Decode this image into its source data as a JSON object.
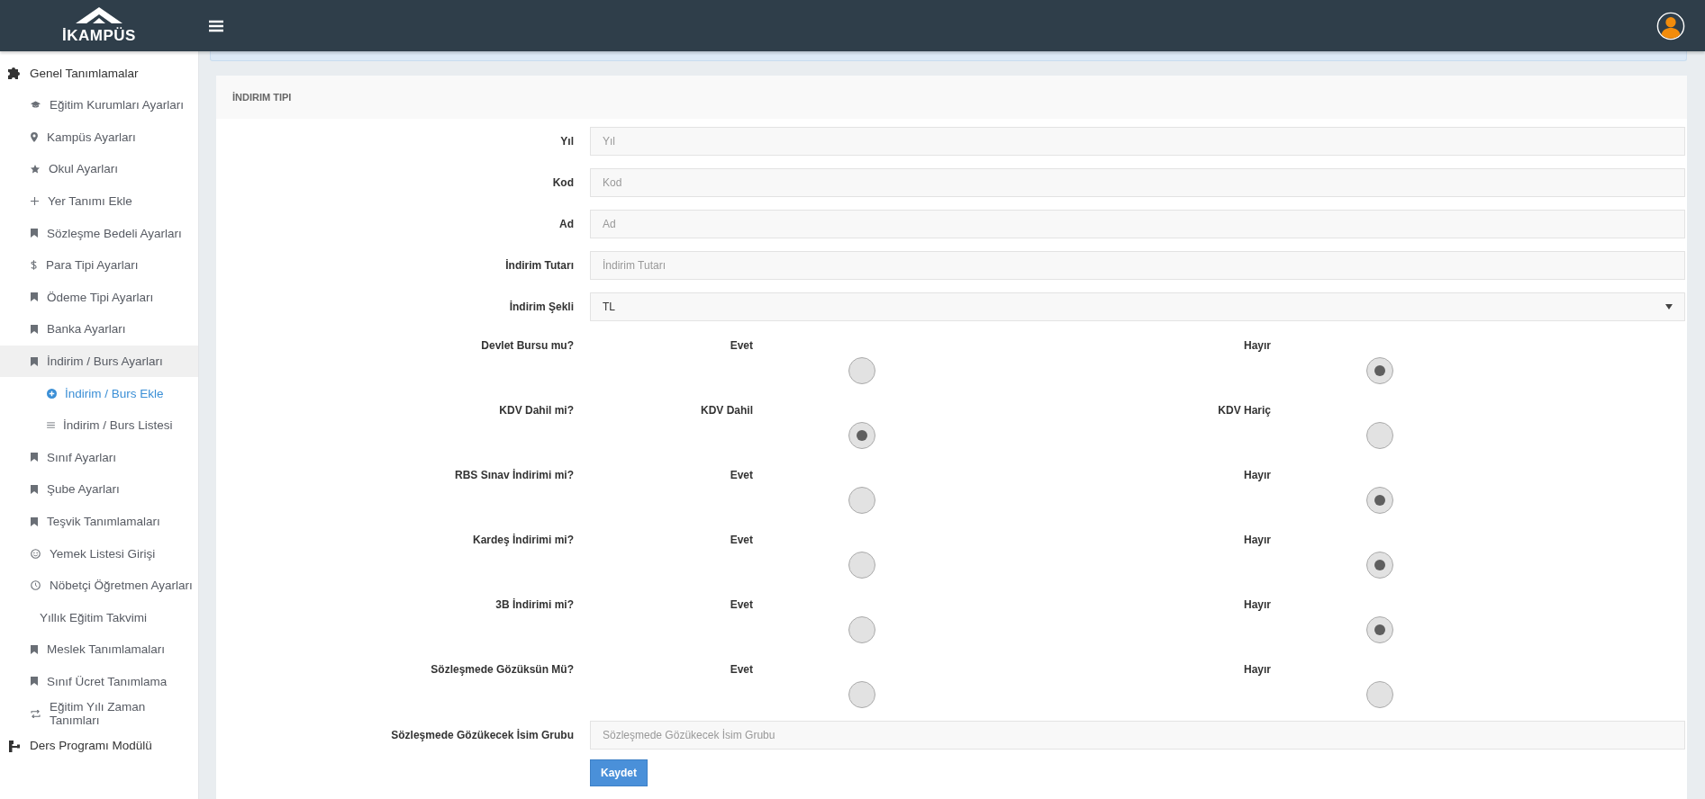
{
  "header": {
    "logo_text": "İKAMPÜS"
  },
  "sidebar": {
    "sections": [
      {
        "label": "Genel Tanımlamalar",
        "expanded": true,
        "items": [
          {
            "label": "Eğitim Kurumları Ayarları",
            "selected": false
          },
          {
            "label": "Kampüs Ayarları",
            "selected": false
          },
          {
            "label": "Okul Ayarları",
            "selected": false
          },
          {
            "label": "Yer Tanımı Ekle",
            "selected": false
          },
          {
            "label": "Sözleşme Bedeli Ayarları",
            "selected": false
          },
          {
            "label": "Para Tipi Ayarları",
            "selected": false
          },
          {
            "label": "Ödeme Tipi Ayarları",
            "selected": false
          },
          {
            "label": "Banka Ayarları",
            "selected": false
          },
          {
            "label": "İndirim / Burs Ayarları",
            "selected": true,
            "children": [
              {
                "label": "İndirim / Burs Ekle",
                "selected": true
              },
              {
                "label": "İndirim / Burs Listesi",
                "selected": false
              }
            ]
          },
          {
            "label": "Sınıf Ayarları",
            "selected": false
          },
          {
            "label": "Şube Ayarları",
            "selected": false
          },
          {
            "label": "Teşvik Tanımlamaları",
            "selected": false
          },
          {
            "label": "Yemek Listesi Girişi",
            "selected": false
          },
          {
            "label": "Nöbetçi Öğretmen Ayarları",
            "selected": false
          },
          {
            "label": "Yıllık Eğitim Takvimi",
            "selected": false
          },
          {
            "label": "Meslek Tanımlamaları",
            "selected": false
          },
          {
            "label": "Sınıf Ücret Tanımlama",
            "selected": false
          },
          {
            "label": "Eğitim Yılı Zaman Tanımları",
            "selected": false
          }
        ]
      },
      {
        "label": "Ders Programı Modülü",
        "expanded": false
      }
    ]
  },
  "card": {
    "title": "İNDIRIM TIPI",
    "fields": [
      {
        "kind": "text",
        "label": "Yıl",
        "placeholder": "Yıl"
      },
      {
        "kind": "text",
        "label": "Kod",
        "placeholder": "Kod"
      },
      {
        "kind": "text",
        "label": "Ad",
        "placeholder": "Ad"
      },
      {
        "kind": "text",
        "label": "İndirim Tutarı",
        "placeholder": "İndirim Tutarı"
      },
      {
        "kind": "select",
        "label": "İndirim Şekli",
        "value": "TL"
      },
      {
        "kind": "radio",
        "label": "Devlet Bursu mu?",
        "options": [
          {
            "label": "Evet",
            "selected": false
          },
          {
            "label": "Hayır",
            "selected": true
          }
        ]
      },
      {
        "kind": "radio",
        "label": "KDV Dahil mi?",
        "options": [
          {
            "label": "KDV Dahil",
            "selected": true
          },
          {
            "label": "KDV Hariç",
            "selected": false
          }
        ]
      },
      {
        "kind": "radio",
        "label": "RBS Sınav İndirimi mi?",
        "options": [
          {
            "label": "Evet",
            "selected": false
          },
          {
            "label": "Hayır",
            "selected": true
          }
        ]
      },
      {
        "kind": "radio",
        "label": "Kardeş İndirimi mi?",
        "options": [
          {
            "label": "Evet",
            "selected": false
          },
          {
            "label": "Hayır",
            "selected": true
          }
        ]
      },
      {
        "kind": "radio",
        "label": "3B İndirimi mi?",
        "options": [
          {
            "label": "Evet",
            "selected": false
          },
          {
            "label": "Hayır",
            "selected": true
          }
        ]
      },
      {
        "kind": "radio",
        "label": "Sözleşmede Gözüksün Mü?",
        "options": [
          {
            "label": "Evet",
            "selected": false
          },
          {
            "label": "Hayır",
            "selected": false
          }
        ]
      },
      {
        "kind": "text",
        "label": "Sözleşmede Gözükecek İsim Grubu",
        "placeholder": "Sözleşmede Gözükecek İsim Grubu"
      }
    ],
    "submit": "Kaydet"
  }
}
